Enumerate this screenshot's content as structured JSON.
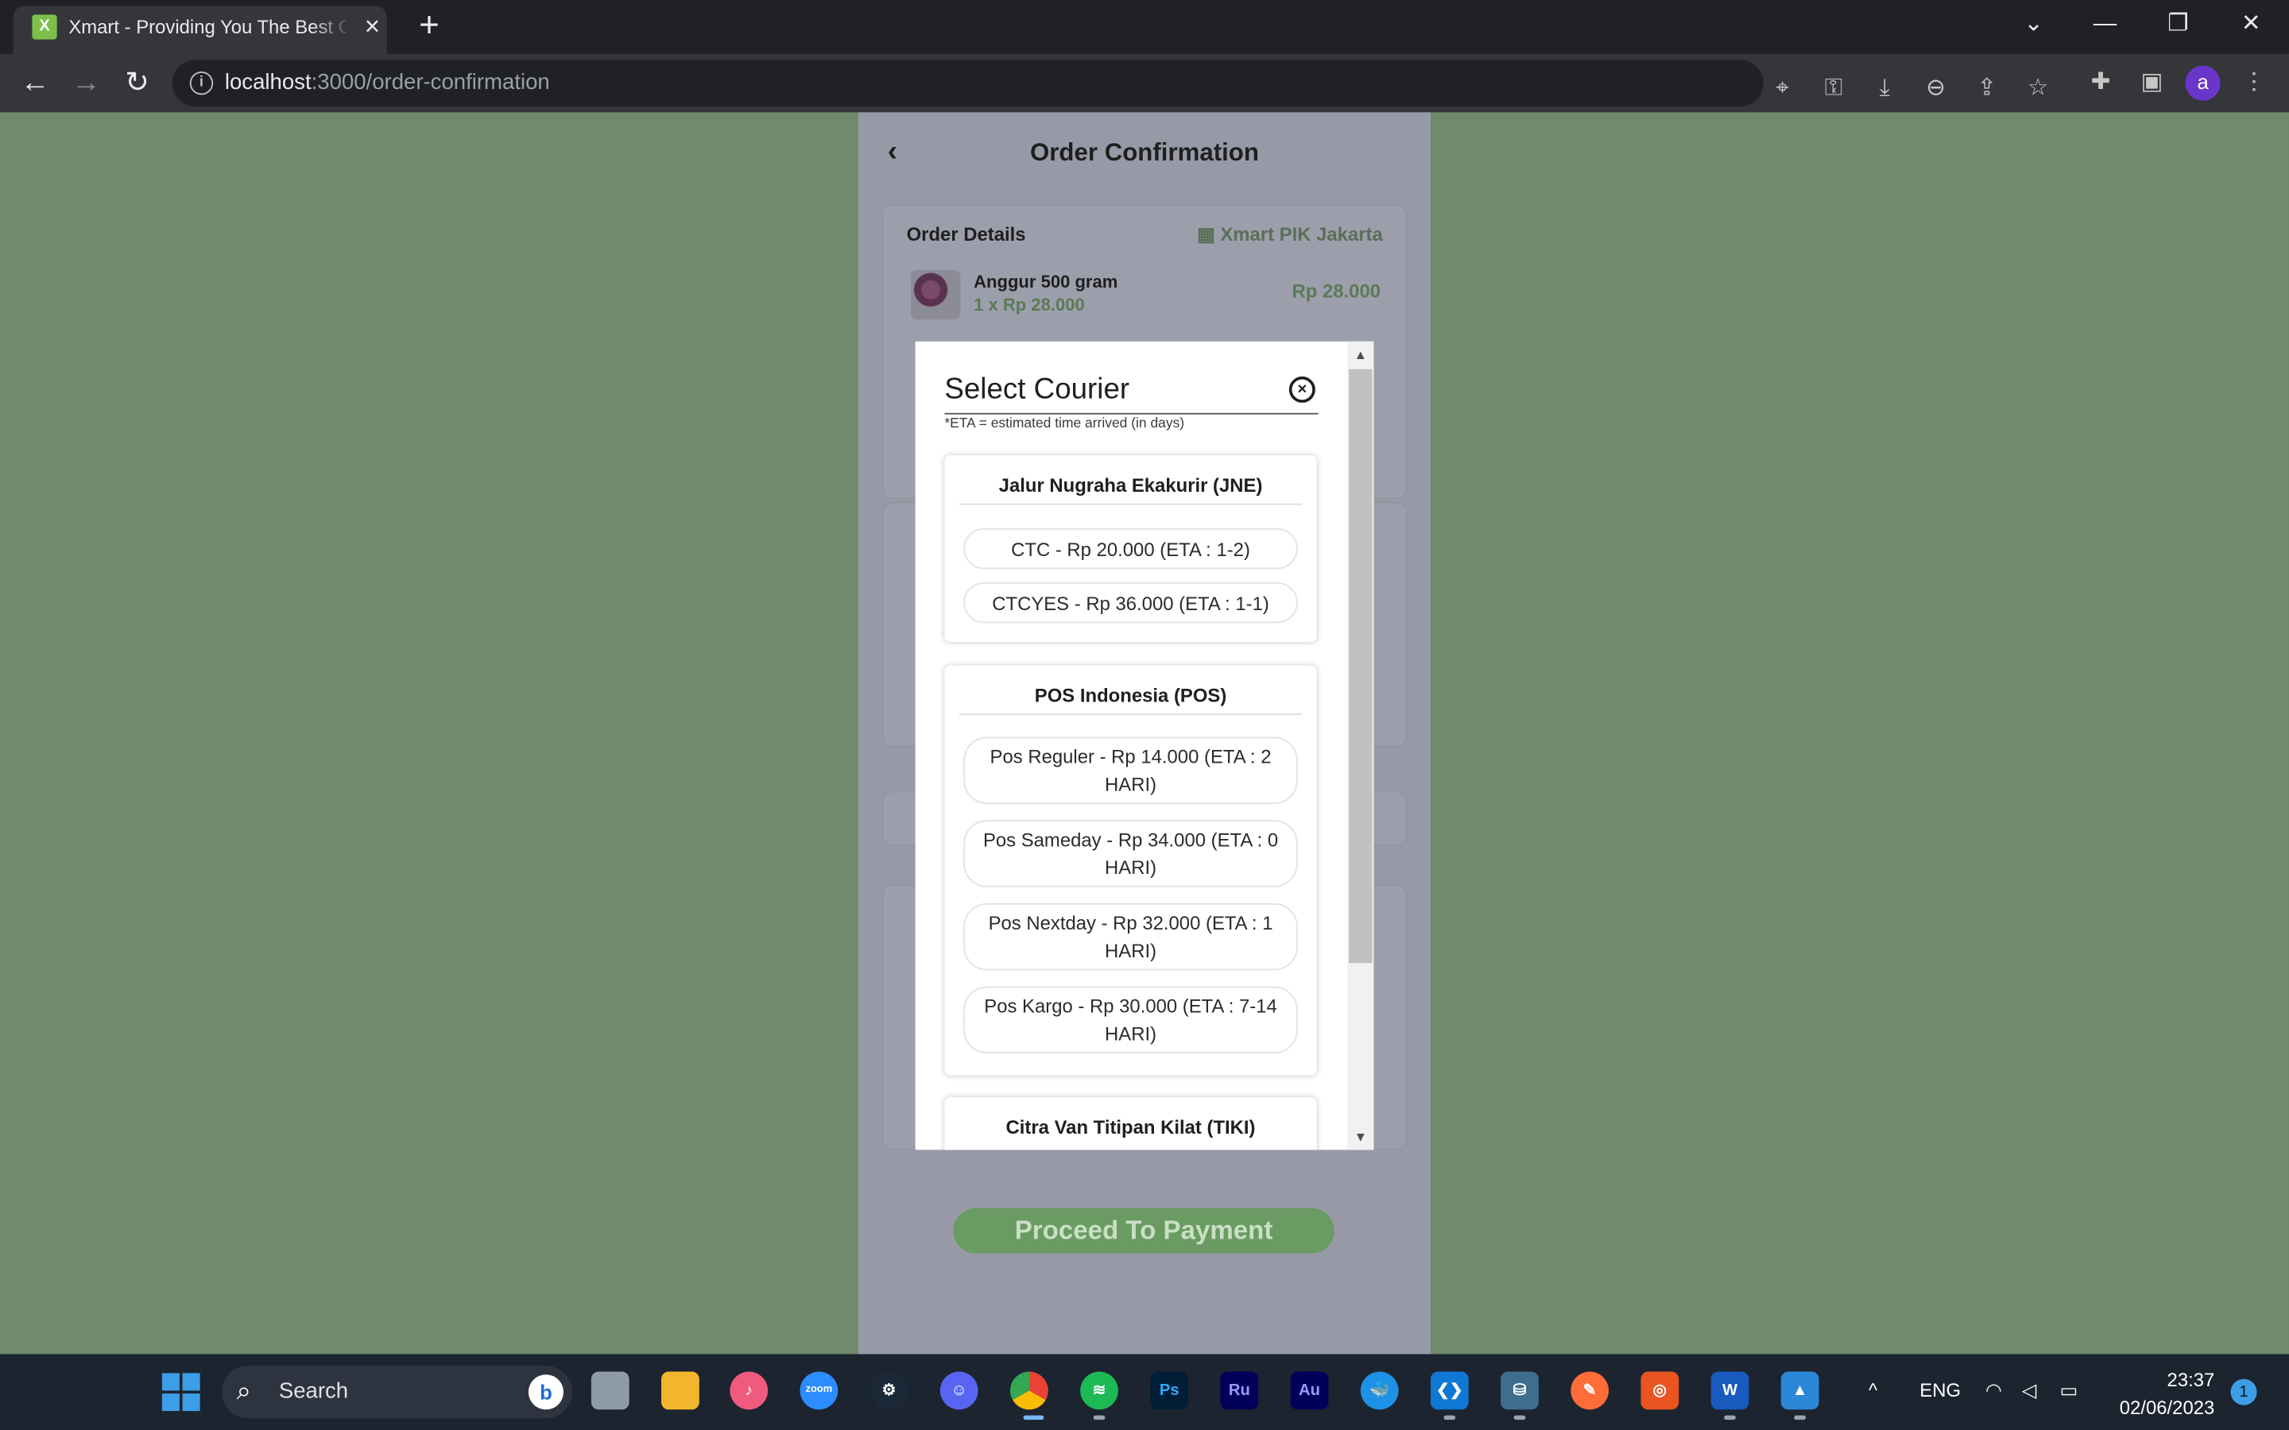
{
  "browser": {
    "tab_title": "Xmart - Providing You The Best G",
    "favicon_letter": "X",
    "url_host": "localhost",
    "url_path": ":3000/order-confirmation",
    "profile_initial": "a"
  },
  "page": {
    "title": "Order Confirmation",
    "order_details_label": "Order Details",
    "store_name": "Xmart PIK Jakarta",
    "item": {
      "name": "Anggur 500 gram",
      "qty_price": "1 x Rp 28.000",
      "price": "Rp 28.000"
    },
    "proceed_label": "Proceed To Payment"
  },
  "modal": {
    "title": "Select Courier",
    "eta_note": "*ETA = estimated time arrived (in days)",
    "groups": [
      {
        "name": "Jalur Nugraha Ekakurir (JNE)",
        "options": [
          "CTC - Rp 20.000 (ETA : 1-2)",
          "CTCYES - Rp 36.000 (ETA : 1-1)"
        ]
      },
      {
        "name": "POS Indonesia (POS)",
        "options": [
          "Pos Reguler - Rp 14.000 (ETA : 2 HARI)",
          "Pos Sameday - Rp 34.000 (ETA : 0 HARI)",
          "Pos Nextday - Rp 32.000 (ETA : 1 HARI)",
          "Pos Kargo - Rp 30.000 (ETA : 7-14 HARI)"
        ]
      },
      {
        "name": "Citra Van Titipan Kilat (TIKI)",
        "options": []
      }
    ]
  },
  "taskbar": {
    "search_placeholder": "Search",
    "language": "ENG",
    "time": "23:37",
    "date": "02/06/2023",
    "notification_count": "1"
  }
}
